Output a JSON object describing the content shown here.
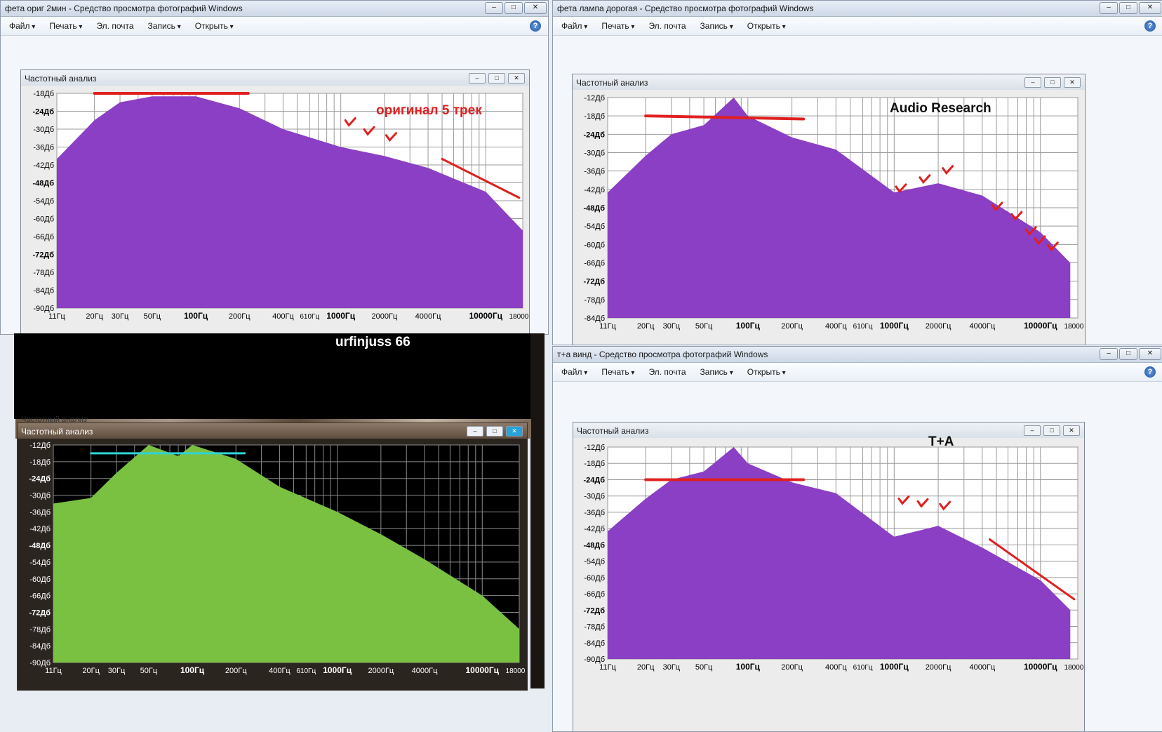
{
  "menu": {
    "file": "Файл",
    "print": "Печать",
    "email": "Эл. почта",
    "burn": "Запись",
    "open": "Открыть"
  },
  "panel_title": "Частотный анализ",
  "freq_labels": [
    "11Гц",
    "20Гц",
    "30Гц",
    "50Гц",
    "100Гц",
    "200Гц",
    "400Гц",
    "610Гц",
    "1000Гц",
    "2000Гц",
    "4000Гц",
    "10000Гц",
    "18000Гц"
  ],
  "bold_freq_labels": [
    "100Гц",
    "1000Гц",
    "10000Гц"
  ],
  "db_labels_a": [
    "-18Дб",
    "-24Дб",
    "-30Дб",
    "-36Дб",
    "-42Дб",
    "-48Дб",
    "-54Дб",
    "-60Дб",
    "-66Дб",
    "-72Дб",
    "-78Дб",
    "-84Дб",
    "-90Дб"
  ],
  "db_labels_b": [
    "-12Дб",
    "-18Дб",
    "-24Дб",
    "-30Дб",
    "-36Дб",
    "-42Дб",
    "-48Дб",
    "-54Дб",
    "-60Дб",
    "-66Дб",
    "-72Дб",
    "-78Дб",
    "-84Дб"
  ],
  "db_labels_c": [
    "-12Дб",
    "-18Дб",
    "-24Дб",
    "-30Дб",
    "-36Дб",
    "-42Дб",
    "-48Дб",
    "-54Дб",
    "-60Дб",
    "-66Дб",
    "-72Дб",
    "-78Дб",
    "-84Дб",
    "-90Дб"
  ],
  "bold_db_labels": [
    "-24Дб",
    "-48Дб",
    "-72Дб"
  ],
  "colors": {
    "spectrum_purple": "#8a3fc4",
    "spectrum_green": "#7ac142",
    "annotation_red": "#e02020",
    "annotation_cyan": "#2fd3d3"
  },
  "win1": {
    "title": "фета ориг 2мин - Средство просмотра фотографий Windows",
    "annotation": "оригинал 5 трек"
  },
  "win2": {
    "title": "фета лампа дорогая - Средство просмотра фотографий Windows",
    "annotation": "Audio Research"
  },
  "win3": {
    "annotation": "urfinjuss 66"
  },
  "win4": {
    "title": "т+а винд - Средство просмотра фотографий Windows",
    "annotation": "T+A"
  },
  "chart_data": [
    {
      "type": "area",
      "title": "оригинал 5 трек",
      "xscale": "log",
      "xlim": [
        11,
        18000
      ],
      "ylim": [
        -90,
        -18
      ],
      "x": [
        11,
        20,
        30,
        50,
        100,
        200,
        400,
        1000,
        2000,
        4000,
        10000,
        18000
      ],
      "y": [
        -40,
        -27,
        -21,
        -19,
        -19,
        -23,
        -30,
        -36,
        -39,
        -43,
        -51,
        -64
      ]
    },
    {
      "type": "area",
      "title": "Audio Research",
      "xscale": "log",
      "xlim": [
        11,
        18000
      ],
      "ylim": [
        -84,
        -12
      ],
      "x": [
        11,
        20,
        30,
        50,
        80,
        100,
        200,
        400,
        1000,
        2000,
        4000,
        10000,
        16000
      ],
      "y": [
        -43,
        -31,
        -24,
        -21,
        -12,
        -18,
        -25,
        -29,
        -43,
        -40,
        -44,
        -56,
        -66
      ]
    },
    {
      "type": "area",
      "title": "urfinjuss 66",
      "xscale": "log",
      "xlim": [
        11,
        18000
      ],
      "ylim": [
        -90,
        -12
      ],
      "x": [
        11,
        20,
        30,
        50,
        80,
        100,
        200,
        400,
        1000,
        2000,
        4000,
        10000,
        18000
      ],
      "y": [
        -33,
        -31,
        -22,
        -12,
        -16,
        -12,
        -17,
        -27,
        -36,
        -44,
        -53,
        -66,
        -78
      ]
    },
    {
      "type": "area",
      "title": "T+A",
      "xscale": "log",
      "xlim": [
        11,
        18000
      ],
      "ylim": [
        -90,
        -12
      ],
      "x": [
        11,
        20,
        30,
        50,
        80,
        100,
        200,
        400,
        1000,
        2000,
        4000,
        10000,
        16000
      ],
      "y": [
        -43,
        -31,
        -24,
        -21,
        -12,
        -18,
        -25,
        -29,
        -45,
        -41,
        -49,
        -61,
        -72
      ]
    }
  ]
}
